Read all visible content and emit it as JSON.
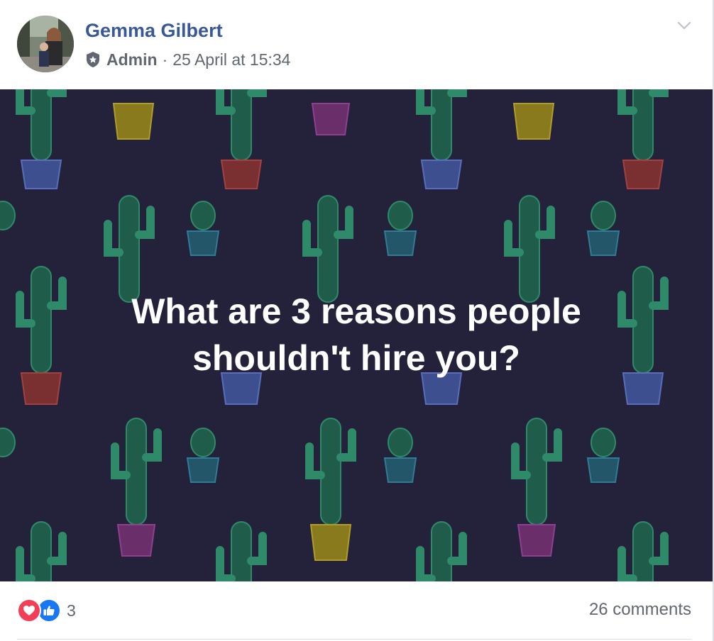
{
  "author": {
    "name": "Gemma Gilbert"
  },
  "meta": {
    "role": "Admin",
    "separator": "·",
    "timestamp": "25 April at 15:34"
  },
  "post": {
    "text_line1": "What are 3 reasons people",
    "text_line2": "shouldn't hire you?",
    "background_color": "#24223a"
  },
  "reactions": {
    "types": [
      "love",
      "like"
    ],
    "count": "3"
  },
  "comments": {
    "label": "26 comments"
  },
  "icons": {
    "admin": "admin-shield-icon",
    "options": "chevron-down-icon",
    "love": "heart-icon",
    "like": "thumbs-up-icon"
  },
  "colors": {
    "name_link": "#385898",
    "meta_text": "#606770",
    "love": "#f33e58",
    "like": "#1877f2"
  }
}
